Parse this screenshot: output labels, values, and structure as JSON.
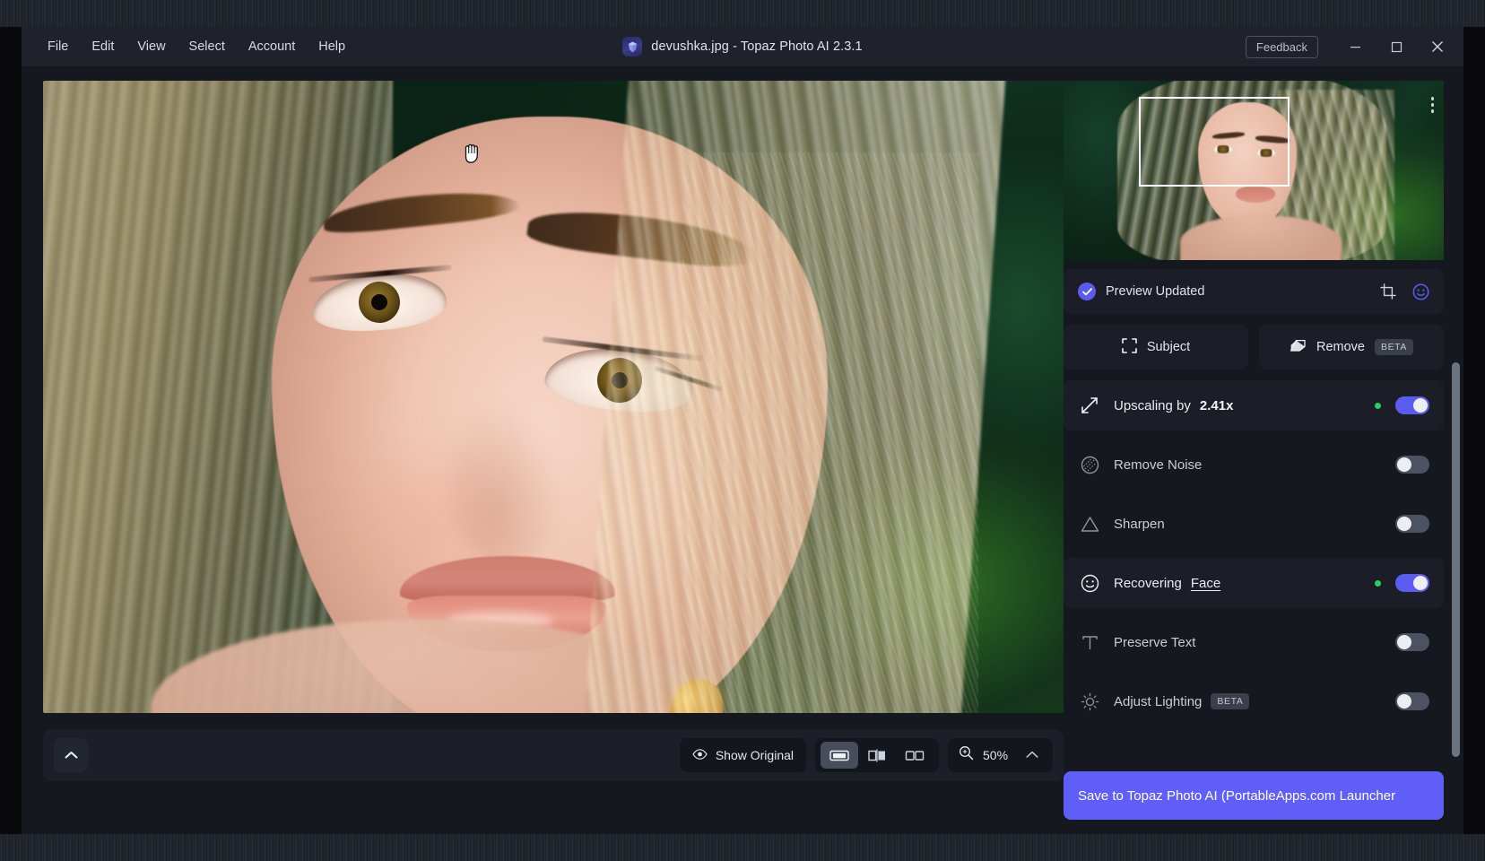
{
  "window": {
    "title": "devushka.jpg - Topaz Photo AI 2.3.1",
    "logo_icon": "topaz-gem-icon",
    "feedback_label": "Feedback",
    "minimize_icon": "minimize-icon",
    "maximize_icon": "maximize-icon",
    "close_icon": "close-icon"
  },
  "menubar": {
    "items": [
      {
        "label": "File"
      },
      {
        "label": "Edit"
      },
      {
        "label": "View"
      },
      {
        "label": "Select"
      },
      {
        "label": "Account"
      },
      {
        "label": "Help"
      }
    ]
  },
  "viewer": {
    "cursor_icon": "open-hand-pan-cursor",
    "collapse_icon": "chevron-up-icon",
    "show_original_label": "Show Original",
    "show_original_icon": "eye-icon",
    "view_modes": [
      {
        "name": "single-view",
        "icon": "single-pane-icon",
        "active": true
      },
      {
        "name": "split-view",
        "icon": "split-pane-icon",
        "active": false
      },
      {
        "name": "side-by-side-view",
        "icon": "side-by-side-icon",
        "active": false
      }
    ],
    "zoom_icon": "magnifier-plus-icon",
    "zoom_value": "50%",
    "zoom_caret_icon": "chevron-up-icon"
  },
  "navigator": {
    "menu_icon": "more-vertical-icon",
    "viewport_rect": "viewport-selection-rect"
  },
  "preview_status": {
    "icon": "check-circle-icon",
    "text": "Preview Updated",
    "actions": [
      {
        "name": "crop-icon",
        "label": "crop"
      },
      {
        "name": "face-smiley-icon",
        "label": "face"
      }
    ]
  },
  "quick_actions": [
    {
      "label": "Subject",
      "icon": "subject-frame-icon",
      "badge": ""
    },
    {
      "label": "Remove",
      "icon": "eraser-icon",
      "badge": "BETA"
    }
  ],
  "filters": [
    {
      "name": "upscaling",
      "icon": "diagonal-arrows-icon",
      "label_prefix": "Upscaling by ",
      "label_strong": "2.41x",
      "label_suffix": "",
      "enabled": true,
      "has_green_dot": true,
      "badge": ""
    },
    {
      "name": "remove-noise",
      "icon": "noise-circle-icon",
      "label_prefix": "Remove Noise",
      "label_strong": "",
      "label_suffix": "",
      "enabled": false,
      "has_green_dot": false,
      "badge": ""
    },
    {
      "name": "sharpen",
      "icon": "triangle-icon",
      "label_prefix": "Sharpen",
      "label_strong": "",
      "label_suffix": "",
      "enabled": false,
      "has_green_dot": false,
      "badge": ""
    },
    {
      "name": "recovering-face",
      "icon": "smiley-face-icon",
      "label_prefix": "Recovering ",
      "label_strong": "",
      "label_underline": "Face",
      "label_suffix": "",
      "enabled": true,
      "has_green_dot": true,
      "badge": ""
    },
    {
      "name": "preserve-text",
      "icon": "text-t-icon",
      "label_prefix": "Preserve Text",
      "label_strong": "",
      "label_suffix": "",
      "enabled": false,
      "has_green_dot": false,
      "badge": ""
    },
    {
      "name": "adjust-lighting",
      "icon": "sun-icon",
      "label_prefix": "Adjust Lighting",
      "label_strong": "",
      "label_suffix": "",
      "enabled": false,
      "has_green_dot": false,
      "badge": "BETA"
    }
  ],
  "save": {
    "label": "Save to Topaz Photo AI (PortableApps.com Launcher"
  },
  "colors": {
    "accent": "#5b5bf0",
    "save_button": "#5f5ff7",
    "panel_bg": "#1b1e26",
    "window_bg": "#16181f",
    "titlebar_bg": "#1f222b",
    "status_green": "#2ecc5f",
    "toggle_off": "#4c5261"
  }
}
